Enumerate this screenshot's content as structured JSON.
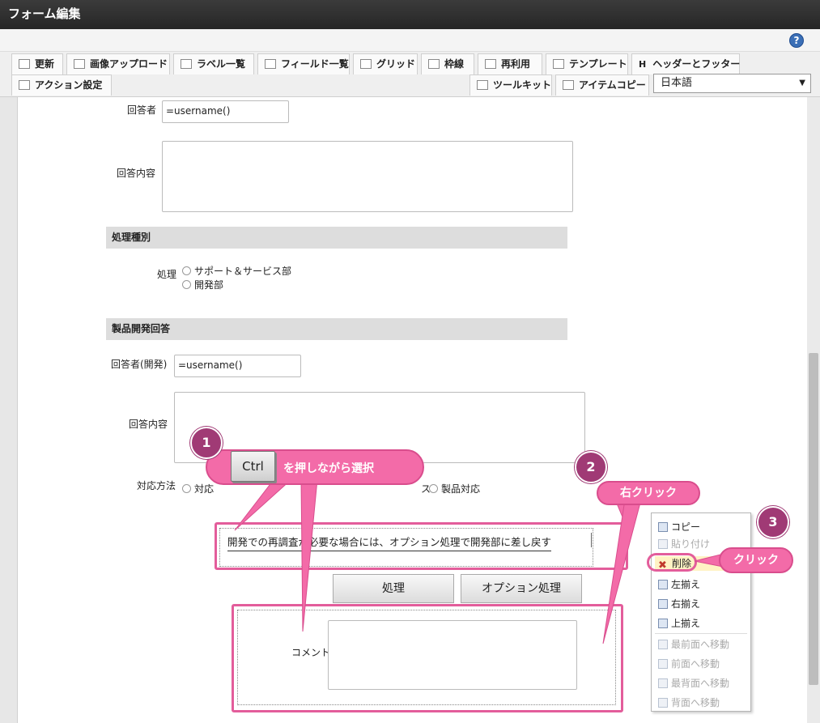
{
  "window": {
    "title": "フォーム編集"
  },
  "toolbar": {
    "tabs": [
      {
        "label": "更新",
        "icon": "refresh-icon"
      },
      {
        "label": "画像アップロード",
        "icon": "image-upload-icon"
      },
      {
        "label": "ラベル一覧",
        "icon": "label-list-icon"
      },
      {
        "label": "フィールド一覧",
        "icon": "field-list-icon"
      },
      {
        "label": "グリッド",
        "icon": "grid-icon"
      },
      {
        "label": "枠線",
        "icon": "border-icon"
      },
      {
        "label": "再利用",
        "icon": "reuse-icon"
      },
      {
        "label": "テンプレート",
        "icon": "template-icon"
      },
      {
        "label": "ヘッダーとフッター",
        "icon": "header-footer-icon"
      },
      {
        "label": "アクション設定",
        "icon": "action-icon"
      },
      {
        "label": "ツールキット",
        "icon": "toolkit-icon"
      },
      {
        "label": "アイテムコピー",
        "icon": "item-copy-icon"
      }
    ],
    "header_footer_glyph": "H",
    "language": "日本語"
  },
  "form": {
    "respondent_label": "回答者",
    "respondent_value": "=username()",
    "answer_label": "回答内容",
    "section_process": "処理種別",
    "process_label": "処理",
    "process_options": [
      "サポート＆サービス部",
      "開発部"
    ],
    "section_product": "製品開発回答",
    "dev_respondent_label": "回答者(開発)",
    "dev_respondent_value": "=username()",
    "dev_answer_label": "回答内容",
    "method_label": "対応方法",
    "method_partial": "対応",
    "method_option_hidden": "ス",
    "method_option_product": "製品対応",
    "note": "開発での再調査が必要な場合には、オプション処理で開発部に差し戻す",
    "btn_process": "処理",
    "btn_option": "オプション処理",
    "comment_label": "コメント"
  },
  "context_menu": {
    "items": [
      {
        "label": "コピー",
        "enabled": true
      },
      {
        "label": "貼り付け",
        "enabled": false
      },
      {
        "label": "削除",
        "enabled": true
      },
      {
        "label": "左揃え",
        "enabled": true
      },
      {
        "label": "右揃え",
        "enabled": true
      },
      {
        "label": "上揃え",
        "enabled": true
      },
      {
        "label": "最前面へ移動",
        "enabled": false
      },
      {
        "label": "前面へ移動",
        "enabled": false
      },
      {
        "label": "最背面へ移動",
        "enabled": false
      },
      {
        "label": "背面へ移動",
        "enabled": false
      }
    ]
  },
  "annotations": {
    "step1_num": "1",
    "ctrl_key": "Ctrl",
    "step1_text": "を押しながら選択",
    "step2_num": "2",
    "step2_text": "右クリック",
    "step3_num": "3",
    "step3_text": "クリック"
  },
  "colors": {
    "accent": "#e35d9b",
    "balloon": "#f36ba8",
    "badge": "#a03a75"
  }
}
